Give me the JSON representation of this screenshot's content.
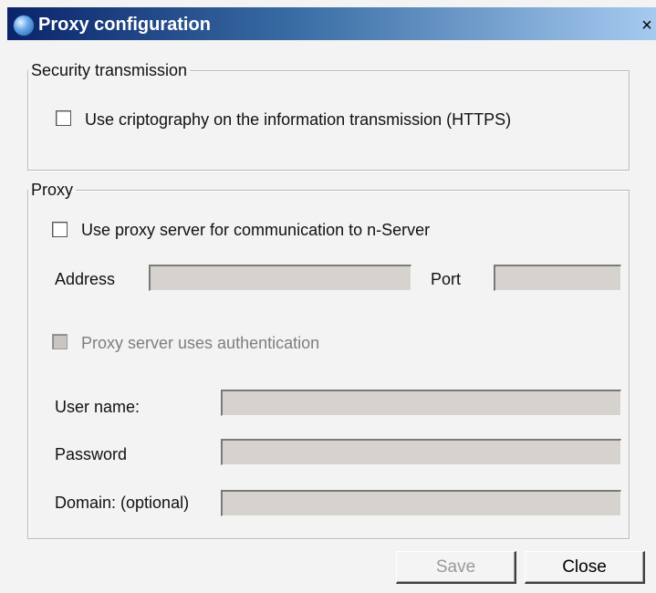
{
  "window": {
    "title": "Proxy configuration",
    "close_glyph": "×",
    "icon": "app-globe-icon"
  },
  "security": {
    "legend": "Security transmission",
    "https_checkbox": {
      "label": "Use criptography on the information transmission (HTTPS)",
      "checked": false
    }
  },
  "proxy": {
    "legend": "Proxy",
    "use_proxy_checkbox": {
      "label": "Use proxy server for communication to n-Server",
      "checked": false
    },
    "address_label": "Address",
    "address_value": "",
    "port_label": "Port",
    "port_value": "",
    "auth_checkbox": {
      "label": "Proxy server uses authentication",
      "checked": false,
      "enabled": false
    },
    "username_label": "User name:",
    "username_value": "",
    "password_label": "Password",
    "password_value": "",
    "domain_label": "Domain: (optional)",
    "domain_value": ""
  },
  "buttons": {
    "save": {
      "label": "Save",
      "enabled": false
    },
    "close": {
      "label": "Close",
      "enabled": true
    }
  },
  "colors": {
    "title_bar_start": "#0a246a",
    "title_bar_end": "#a6caf0",
    "window_background": "#f3f3f3",
    "disabled_field": "#d6d3ce"
  }
}
